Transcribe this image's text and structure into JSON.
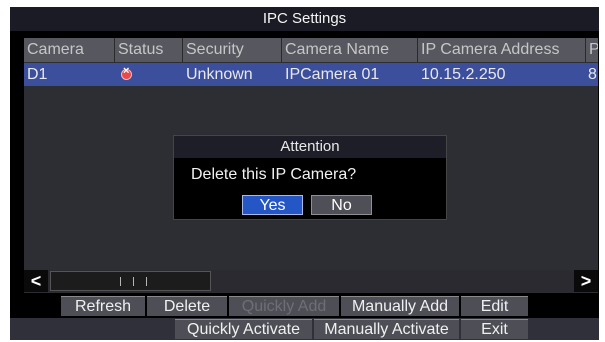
{
  "window": {
    "title": "IPC Settings"
  },
  "table": {
    "columns": [
      "Camera",
      "Status",
      "Security",
      "Camera Name",
      "IP Camera Address",
      "P"
    ],
    "rows": [
      {
        "camera": "D1",
        "status_icon": "offline-x-icon",
        "security": "Unknown",
        "name": "IPCamera 01",
        "address": "10.15.2.250",
        "port": "8"
      }
    ]
  },
  "scrollbar": {
    "left_arrow": "<",
    "right_arrow": ">"
  },
  "dialog": {
    "title": "Attention",
    "message": "Delete this IP Camera?",
    "yes_label": "Yes",
    "no_label": "No"
  },
  "buttons": {
    "refresh": "Refresh",
    "delete": "Delete",
    "quickly_add": "Quickly Add",
    "manually_add": "Manually Add",
    "edit": "Edit",
    "quickly_activate": "Quickly Activate",
    "manually_activate": "Manually Activate",
    "exit": "Exit"
  },
  "colors": {
    "selected_row": "#3c4f9c",
    "dialog_yes": "#2556c6",
    "status_offline": "#e84a4a"
  }
}
